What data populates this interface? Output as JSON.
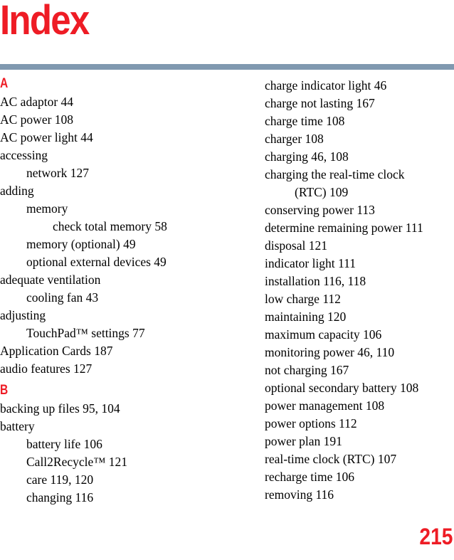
{
  "document": {
    "title": "Index",
    "page_number": "215",
    "divider_color": "#8099b0",
    "accent_color": "#ee1c25"
  },
  "columns": {
    "left": {
      "blocks": [
        {
          "letter": "A",
          "entries": [
            {
              "level": 0,
              "text": "AC adaptor 44"
            },
            {
              "level": 0,
              "text": "AC power 108"
            },
            {
              "level": 0,
              "text": "AC power light 44"
            },
            {
              "level": 0,
              "text": "accessing"
            },
            {
              "level": 1,
              "text": "network 127"
            },
            {
              "level": 0,
              "text": "adding"
            },
            {
              "level": 1,
              "text": "memory"
            },
            {
              "level": 2,
              "text": "check total memory 58"
            },
            {
              "level": 1,
              "text": "memory (optional) 49"
            },
            {
              "level": 1,
              "text": "optional external devices 49"
            },
            {
              "level": 0,
              "text": "adequate ventilation"
            },
            {
              "level": 1,
              "text": "cooling fan 43"
            },
            {
              "level": 0,
              "text": "adjusting"
            },
            {
              "level": 1,
              "text": "TouchPad™ settings 77"
            },
            {
              "level": 0,
              "text": "Application Cards 187"
            },
            {
              "level": 0,
              "text": "audio features 127"
            }
          ]
        },
        {
          "letter": "B",
          "entries": [
            {
              "level": 0,
              "text": "backing up files 95, 104"
            },
            {
              "level": 0,
              "text": "battery"
            },
            {
              "level": 1,
              "text": "battery life 106"
            },
            {
              "level": 1,
              "text": "Call2Recycle™ 121"
            },
            {
              "level": 1,
              "text": "care 119, 120"
            },
            {
              "level": 1,
              "text": "changing 116"
            }
          ]
        }
      ]
    },
    "right": {
      "blocks": [
        {
          "letter": "",
          "entries": [
            {
              "level": 0,
              "text": "charge indicator light 46"
            },
            {
              "level": 0,
              "text": "charge not lasting 167"
            },
            {
              "level": 0,
              "text": "charge time 108"
            },
            {
              "level": 0,
              "text": "charger 108"
            },
            {
              "level": 0,
              "text": "charging 46, 108"
            },
            {
              "level": 0,
              "text": "charging the real-time clock"
            },
            {
              "level": 3,
              "text": "(RTC) 109"
            },
            {
              "level": 0,
              "text": "conserving power 113"
            },
            {
              "level": 0,
              "text": "determine remaining power 111"
            },
            {
              "level": 0,
              "text": "disposal 121"
            },
            {
              "level": 0,
              "text": "indicator light 111"
            },
            {
              "level": 0,
              "text": "installation 116, 118"
            },
            {
              "level": 0,
              "text": "low charge 112"
            },
            {
              "level": 0,
              "text": "maintaining 120"
            },
            {
              "level": 0,
              "text": "maximum capacity 106"
            },
            {
              "level": 0,
              "text": "monitoring power 46, 110"
            },
            {
              "level": 0,
              "text": "not charging 167"
            },
            {
              "level": 0,
              "text": "optional secondary battery 108"
            },
            {
              "level": 0,
              "text": "power management 108"
            },
            {
              "level": 0,
              "text": "power options 112"
            },
            {
              "level": 0,
              "text": "power plan 191"
            },
            {
              "level": 0,
              "text": "real-time clock (RTC) 107"
            },
            {
              "level": 0,
              "text": "recharge time 106"
            },
            {
              "level": 0,
              "text": "removing 116"
            }
          ]
        }
      ]
    }
  }
}
